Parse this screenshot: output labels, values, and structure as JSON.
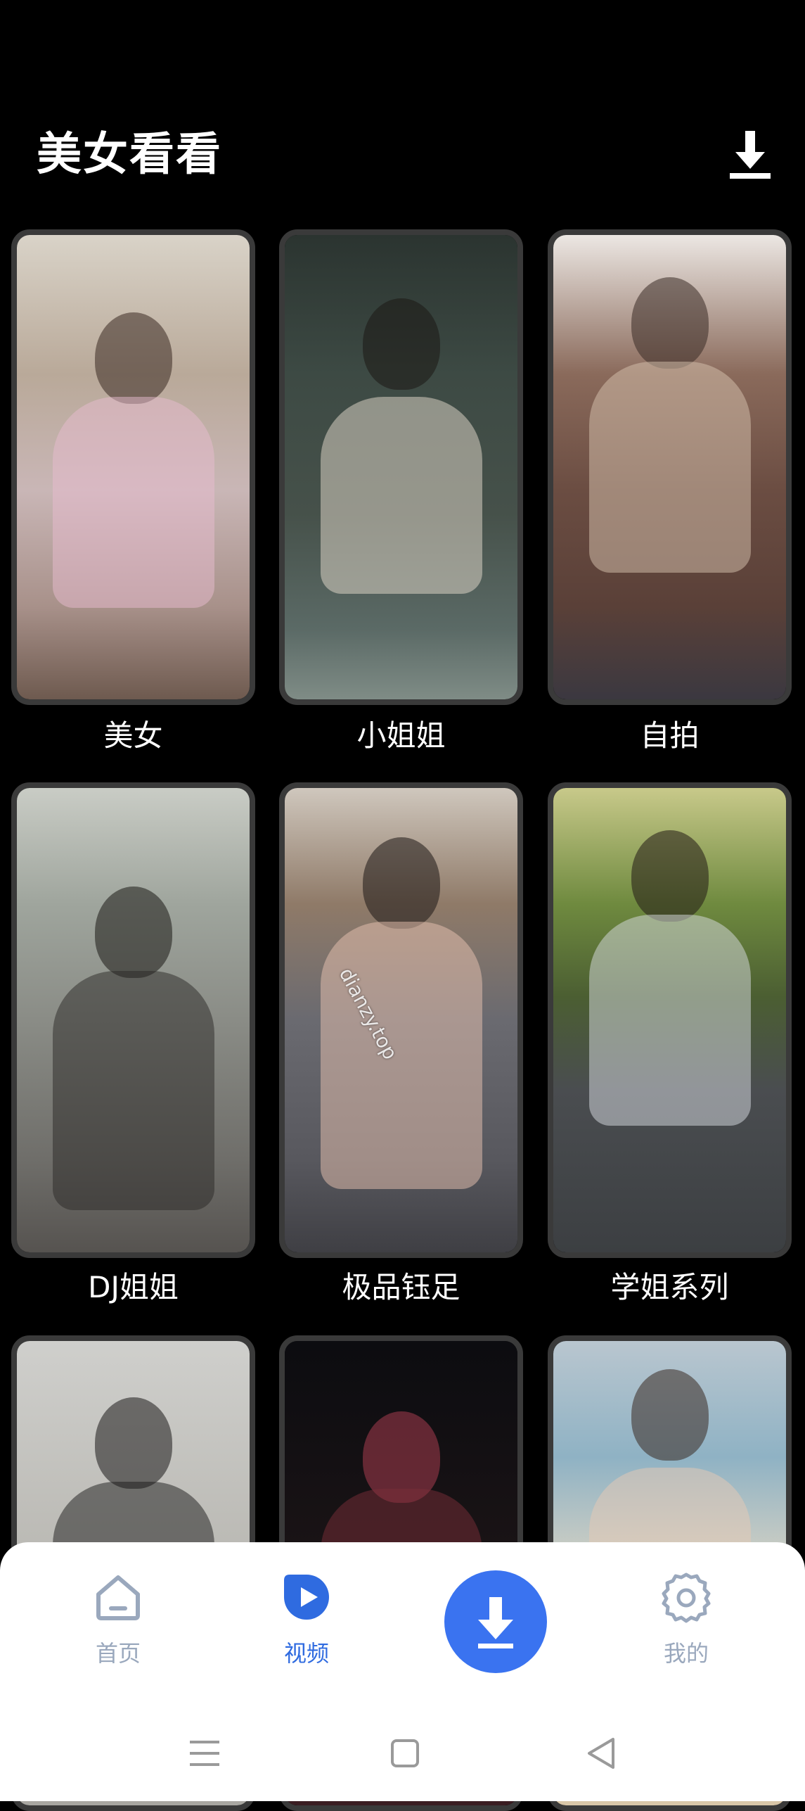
{
  "header": {
    "title": "美女看看",
    "download_icon": "download-icon"
  },
  "categories": [
    {
      "label": "美女",
      "watermark": ""
    },
    {
      "label": "小姐姐",
      "watermark": ""
    },
    {
      "label": "自拍",
      "watermark": ""
    },
    {
      "label": "DJ姐姐",
      "watermark": ""
    },
    {
      "label": "极品钰足",
      "watermark": "dianzy.top"
    },
    {
      "label": "学姐系列",
      "watermark": ""
    },
    {
      "label": "",
      "watermark": ""
    },
    {
      "label": "",
      "watermark": ""
    },
    {
      "label": "",
      "watermark": ""
    }
  ],
  "bottom_nav": {
    "items": [
      {
        "label": "首页",
        "icon": "home-icon",
        "active": false
      },
      {
        "label": "视频",
        "icon": "play-icon",
        "active": true
      },
      {
        "label": "",
        "icon": "download-icon",
        "active": false
      },
      {
        "label": "我的",
        "icon": "gear-icon",
        "active": false
      }
    ],
    "active_color": "#2f6be0",
    "inactive_color": "#9aa8bd",
    "fab_color": "#3a73f0"
  },
  "system_nav": {
    "icons": [
      "menu-icon",
      "square-icon",
      "back-triangle-icon"
    ]
  }
}
